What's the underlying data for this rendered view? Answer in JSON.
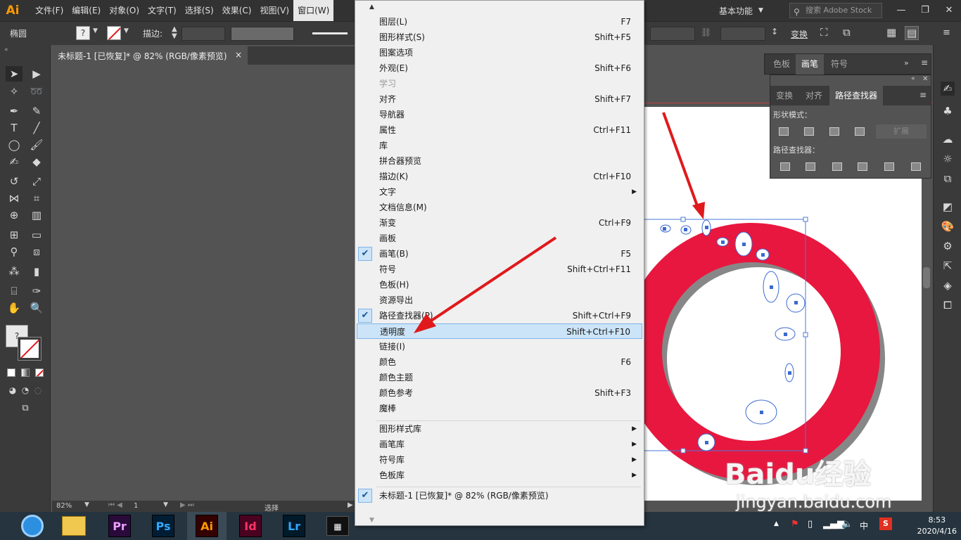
{
  "menubar": {
    "logo": "Ai",
    "items": [
      {
        "label": "文件(F)"
      },
      {
        "label": "编辑(E)"
      },
      {
        "label": "对象(O)"
      },
      {
        "label": "文字(T)"
      },
      {
        "label": "选择(S)"
      },
      {
        "label": "效果(C)"
      },
      {
        "label": "视图(V)"
      },
      {
        "label": "窗口(W)"
      }
    ],
    "workspace": "基本功能",
    "search_placeholder": "搜索 Adobe Stock"
  },
  "control_bar": {
    "object_label": "椭圆",
    "stroke_label": "描边:",
    "transform_label": "变换"
  },
  "document_tab": {
    "title": "未标题-1 [已恢复]* @ 82% (RGB/像素预览)",
    "close": "×"
  },
  "status_bar": {
    "zoom": "82%",
    "page": "1",
    "tool": "选择"
  },
  "window_menu": {
    "items": [
      {
        "label": "图层(L)",
        "shortcut": "F7"
      },
      {
        "label": "图形样式(S)",
        "shortcut": "Shift+F5"
      },
      {
        "label": "图案选项",
        "shortcut": ""
      },
      {
        "label": "外观(E)",
        "shortcut": "Shift+F6"
      },
      {
        "label": "学习",
        "shortcut": "",
        "disabled": true
      },
      {
        "label": "对齐",
        "shortcut": "Shift+F7"
      },
      {
        "label": "导航器",
        "shortcut": ""
      },
      {
        "label": "属性",
        "shortcut": "Ctrl+F11"
      },
      {
        "label": "库",
        "shortcut": ""
      },
      {
        "label": "拼合器预览",
        "shortcut": ""
      },
      {
        "label": "描边(K)",
        "shortcut": "Ctrl+F10"
      },
      {
        "label": "文字",
        "shortcut": "",
        "submenu": true
      },
      {
        "label": "文档信息(M)",
        "shortcut": ""
      },
      {
        "label": "渐变",
        "shortcut": "Ctrl+F9"
      },
      {
        "label": "画板",
        "shortcut": ""
      },
      {
        "label": "画笔(B)",
        "shortcut": "F5",
        "checked": true
      },
      {
        "label": "符号",
        "shortcut": "Shift+Ctrl+F11"
      },
      {
        "label": "色板(H)",
        "shortcut": ""
      },
      {
        "label": "资源导出",
        "shortcut": ""
      },
      {
        "label": "路径查找器(P)",
        "shortcut": "Shift+Ctrl+F9",
        "checked": true
      },
      {
        "label": "透明度",
        "shortcut": "Shift+Ctrl+F10",
        "highlighted": true
      },
      {
        "label": "链接(I)",
        "shortcut": ""
      },
      {
        "label": "颜色",
        "shortcut": "F6"
      },
      {
        "label": "颜色主题",
        "shortcut": ""
      },
      {
        "label": "颜色参考",
        "shortcut": "Shift+F3"
      },
      {
        "label": "魔棒",
        "shortcut": ""
      }
    ],
    "libraries": [
      {
        "label": "图形样式库"
      },
      {
        "label": "画笔库"
      },
      {
        "label": "符号库"
      },
      {
        "label": "色板库"
      }
    ],
    "open_document": "未标题-1 [已恢复]* @ 82% (RGB/像素预览)"
  },
  "panels": {
    "group1_tabs": [
      "色板",
      "画笔",
      "符号"
    ],
    "group2_tabs": [
      "变换",
      "对齐",
      "路径查找器"
    ],
    "shape_modes_label": "形状模式：",
    "expand_label": "扩展",
    "pathfinders_label": "路径查找器："
  },
  "taskbar": {
    "apps": [
      "Pr",
      "Ps",
      "Ai",
      "Id",
      "Lr"
    ],
    "time": "8:53",
    "date": "2020/4/16",
    "ime": "中"
  },
  "watermark": {
    "brand": "Baidu经验",
    "url": "jingyan.baidu.com"
  },
  "colors": {
    "ring_fill": "#e8173f",
    "arrow": "#e0191c",
    "menu_highlight": "#cce4f7"
  }
}
